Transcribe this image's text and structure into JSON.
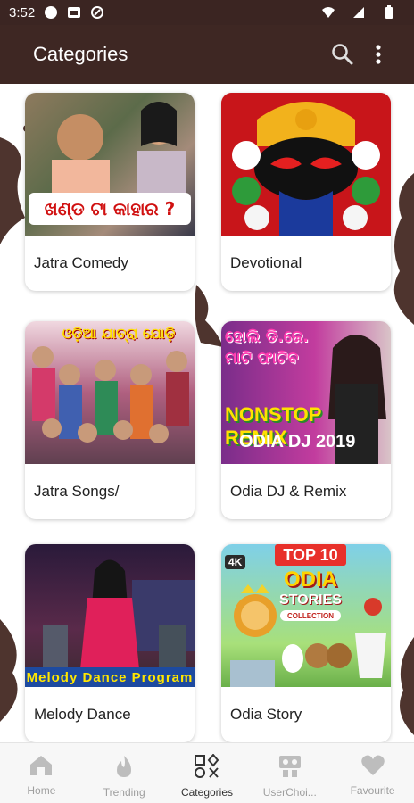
{
  "status_bar": {
    "time": "3:52"
  },
  "app_bar": {
    "title": "Categories",
    "search_icon": "search-icon",
    "menu_icon": "more-vert-icon"
  },
  "categories": [
    {
      "label": "Jatra Comedy",
      "thumb_text": "ଖଣ୍ଡ ଟା କାହାର ?"
    },
    {
      "label": "Devotional",
      "thumb_text": ""
    },
    {
      "label": "Jatra Songs/",
      "thumb_text": "ଓଡ଼ିଆ ଯାତ୍ରା ଯୋଡ଼ି"
    },
    {
      "label": "Odia DJ & Remix",
      "thumb_text": "ହୋଲି ଡି.ଜେ. ମାଟି ଫାଟିବ",
      "thumb_text2": "NONSTOP REMIX",
      "thumb_text3": "ODIA DJ 2019"
    },
    {
      "label": "Melody Dance",
      "thumb_text": "Melody Dance Program"
    },
    {
      "label": "Odia Story",
      "thumb_text": "TOP 10",
      "thumb_text2": "ODIA",
      "thumb_text3": "STORIES",
      "thumb_text4": "4K",
      "thumb_text5": "COLLECTION"
    }
  ],
  "bottom_nav": [
    {
      "label": "Home",
      "icon": "home-icon",
      "active": false
    },
    {
      "label": "Trending",
      "icon": "fire-icon",
      "active": false
    },
    {
      "label": "Categories",
      "icon": "categories-icon",
      "active": true
    },
    {
      "label": "UserChoi...",
      "icon": "user-choice-icon",
      "active": false
    },
    {
      "label": "Favourite",
      "icon": "heart-icon",
      "active": false
    }
  ],
  "colors": {
    "app_bar": "#3e2723",
    "status_bar": "#3b2522",
    "decoration": "#4e342e"
  }
}
